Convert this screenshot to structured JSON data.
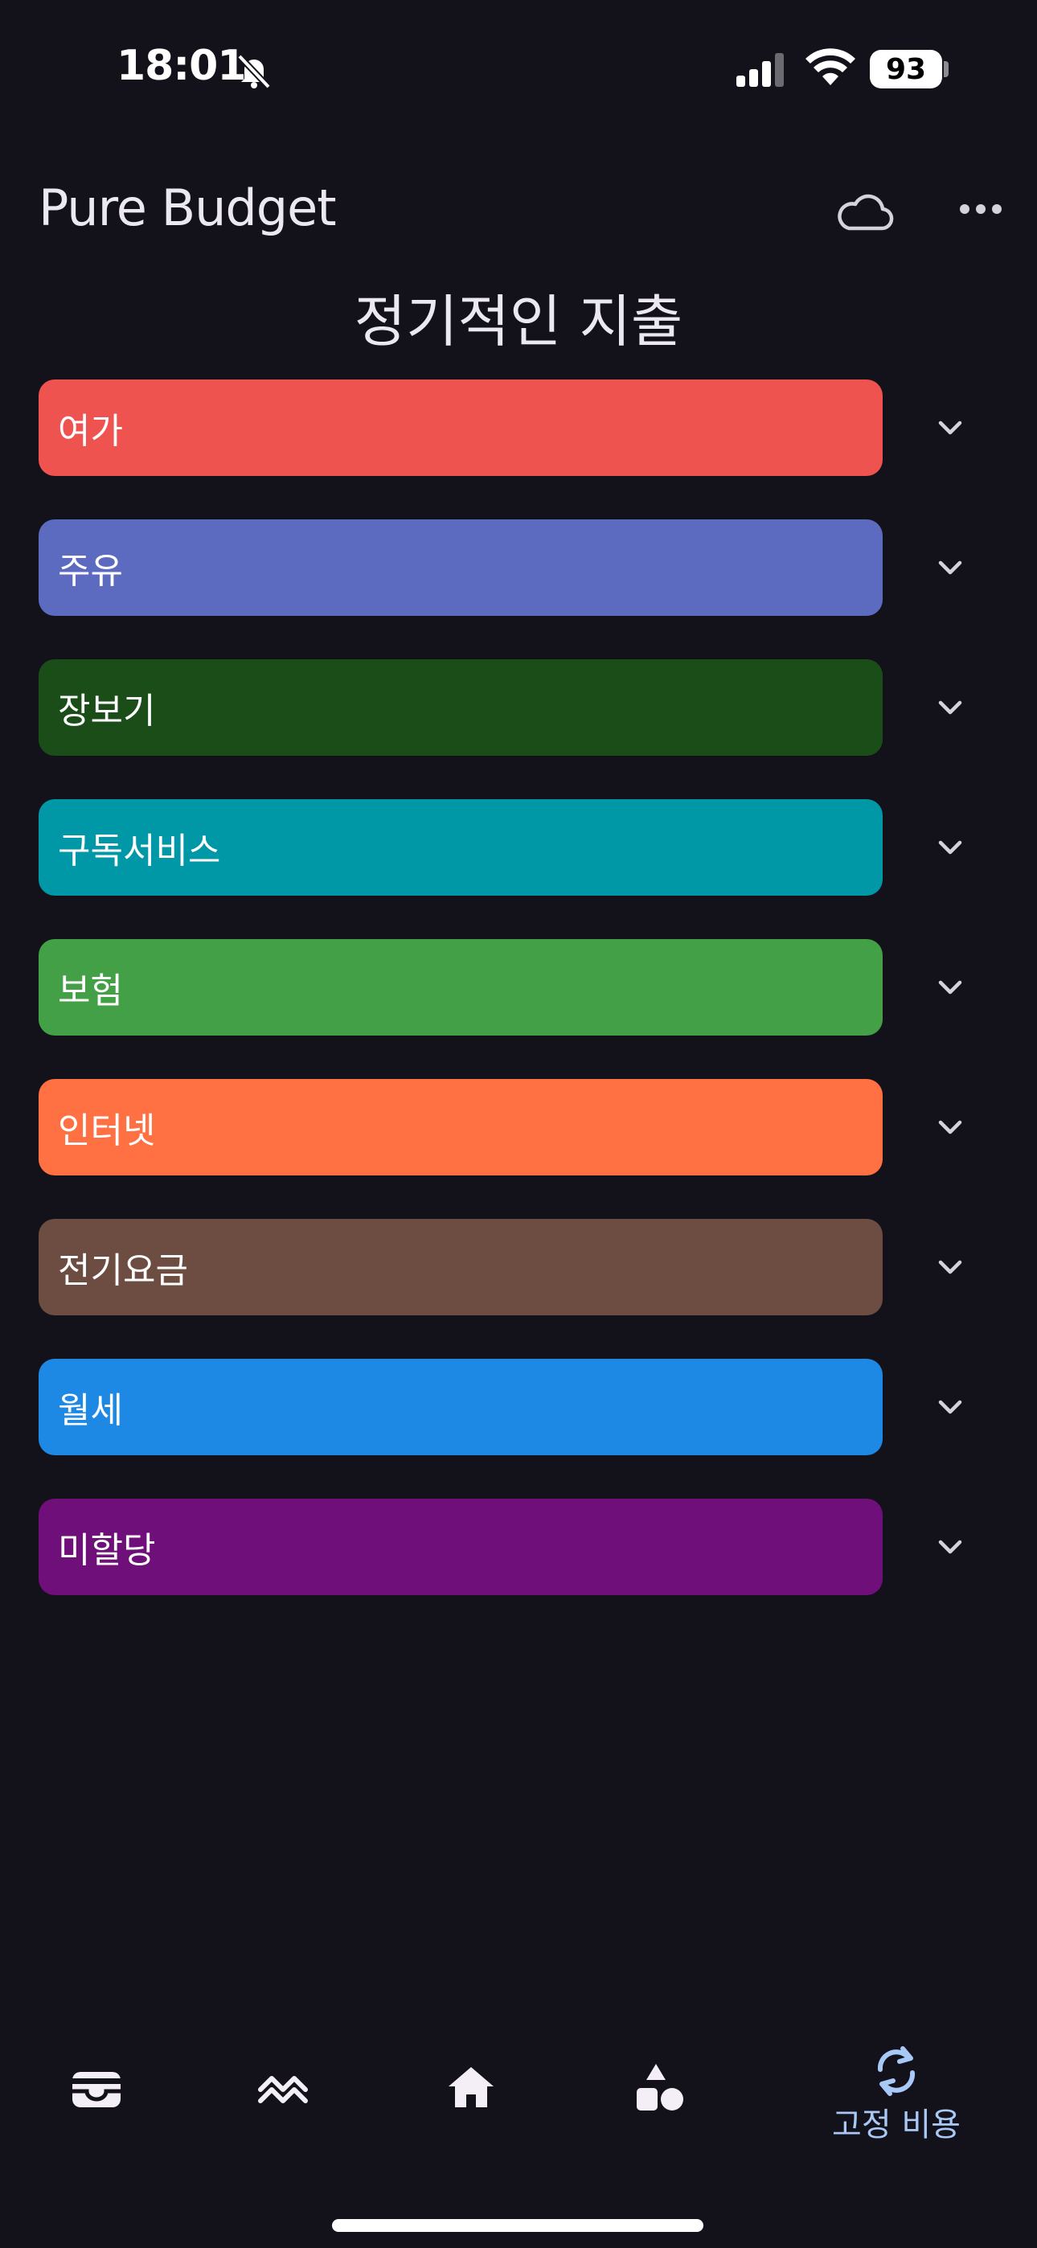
{
  "status_bar": {
    "time": "18:01",
    "battery": "93",
    "icons": [
      "bell-slash-icon",
      "cellular-signal-icon",
      "wifi-icon",
      "battery-icon"
    ]
  },
  "header": {
    "app_title": "Pure Budget",
    "icons": [
      "cloud-icon",
      "more-dots-icon"
    ]
  },
  "page_title": "정기적인 지출",
  "categories": [
    {
      "label": "여가",
      "color": "#ef5350"
    },
    {
      "label": "주유",
      "color": "#5c6bc0"
    },
    {
      "label": "장보기",
      "color": "#1b4d18"
    },
    {
      "label": "구독서비스",
      "color": "#0097a7"
    },
    {
      "label": "보험",
      "color": "#43a047"
    },
    {
      "label": "인터넷",
      "color": "#ff7043"
    },
    {
      "label": "전기요금",
      "color": "#6d4c41"
    },
    {
      "label": "월세",
      "color": "#1e88e5"
    },
    {
      "label": "미할당",
      "color": "#6f0f7a"
    }
  ],
  "bottom_nav": {
    "items": [
      "wallet-icon",
      "trend-icon",
      "home-icon",
      "shapes-icon",
      "refresh-icon"
    ],
    "active_label": "고정 비용",
    "active_color": "#a8c8f5"
  }
}
